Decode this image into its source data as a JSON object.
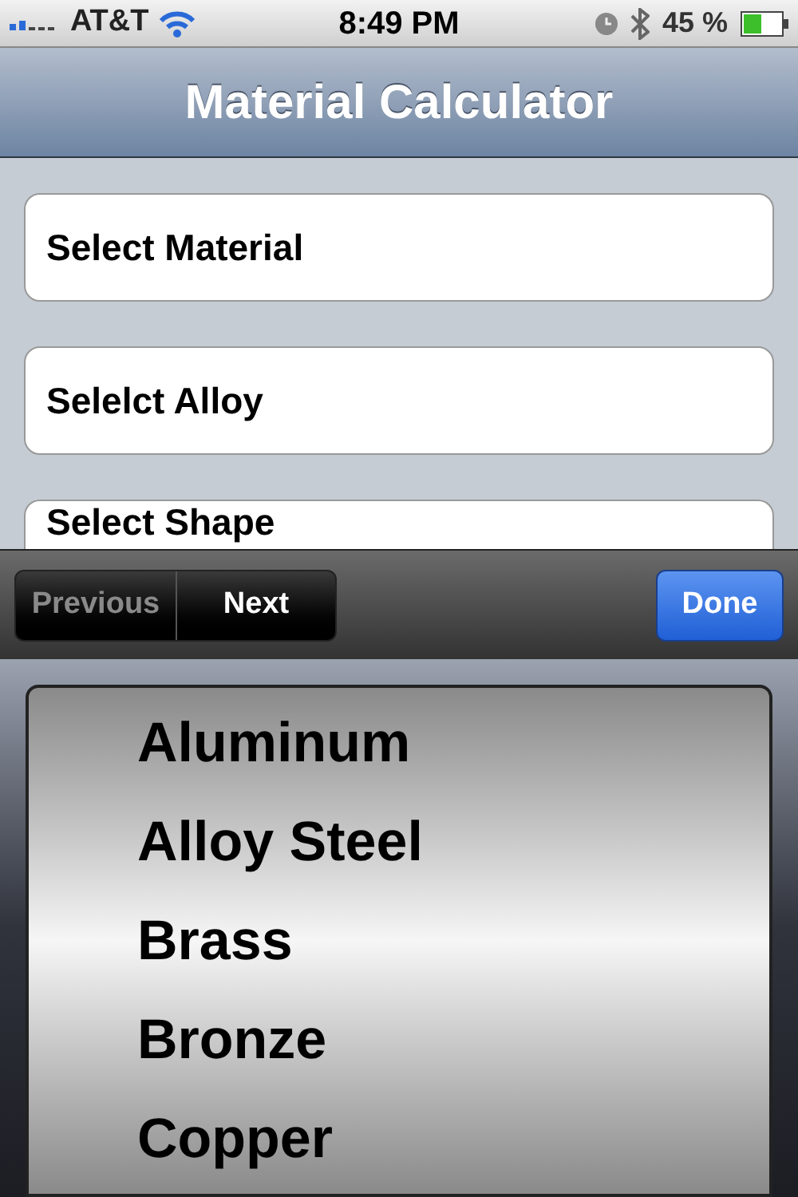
{
  "status_bar": {
    "carrier": "AT&T",
    "time": "8:49 PM",
    "battery": "45 %"
  },
  "nav_bar": {
    "title": "Material Calculator"
  },
  "fields": [
    {
      "label": "Select Material"
    },
    {
      "label": "Selelct Alloy"
    },
    {
      "label": "Select Shape"
    }
  ],
  "toolbar": {
    "segments": [
      {
        "label": "Previous",
        "disabled": true
      },
      {
        "label": "Next",
        "disabled": false
      }
    ],
    "done": "Done"
  },
  "picker": {
    "items": [
      "Aluminum",
      "Alloy Steel",
      "Brass",
      "Bronze",
      "Copper"
    ]
  }
}
